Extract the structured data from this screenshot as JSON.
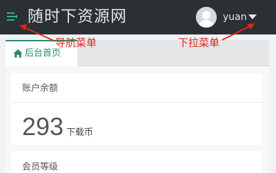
{
  "navbar": {
    "site_title": "随时下资源网",
    "username": "yuan",
    "background": "#2b3035",
    "menu_icon": "menu-toggle-icon",
    "dropdown_icon": "caret-down-icon"
  },
  "annotations": {
    "nav_menu": "导航菜单",
    "dropdown_menu": "下拉菜单",
    "color": "#e0261a"
  },
  "tabs": [
    {
      "label": "后台首页",
      "icon": "home-icon",
      "active": true
    }
  ],
  "cards": {
    "balance": {
      "title": "账户余额",
      "value": "293",
      "unit": "下载币"
    },
    "level": {
      "title": "会员等级"
    }
  },
  "accent": "#2b8a6e"
}
